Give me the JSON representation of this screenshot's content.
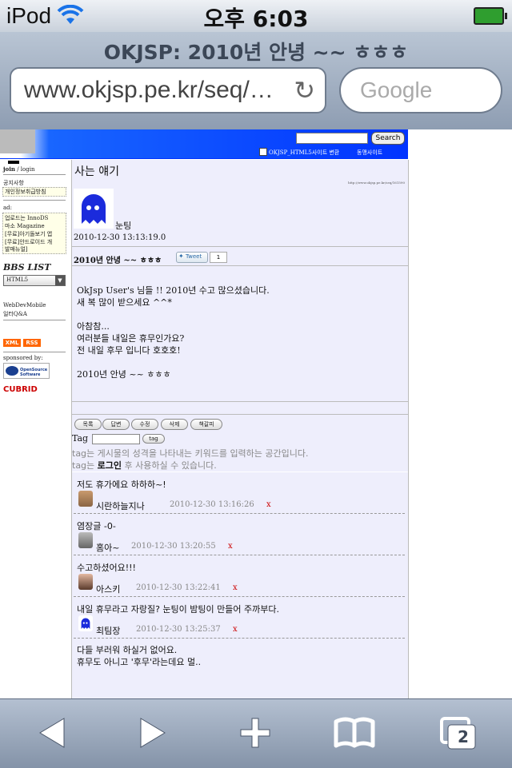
{
  "status": {
    "carrier": "iPod",
    "time": "오후 6:03"
  },
  "browser": {
    "title": "OKJSP: 2010년 안녕 ~~ ㅎㅎㅎ",
    "url": "www.okjsp.pe.kr/seq/…",
    "search_placeholder": "Google",
    "tabs_count": "2"
  },
  "site": {
    "search_button": "Search",
    "link_html5": "OKJSP_HTML5사이트 변환",
    "link_alumni": "동맹사이트"
  },
  "sidebar": {
    "join": "join",
    "sep": "/",
    "login": "login",
    "notice": "공지사항",
    "privacy": "개인정보취급방침",
    "ad_label": "ad:",
    "ads": [
      "업로드는 InnoDS",
      "마소 Magazine",
      "[무료]아기돌보기 앱",
      "[무료]안드로이드 개",
      "발매뉴얼]"
    ],
    "bbs_list": "BBS LIST",
    "bbs_select": "HTML5",
    "links": [
      "WebDevMobile",
      "일터Q&A"
    ],
    "xml": "XML",
    "rss": "RSS",
    "sponsored": "sponsored by:",
    "sponsor1": "OpenSource Software",
    "sponsor2": "CUBRID"
  },
  "post": {
    "board": "사는 얘기",
    "permalink": "http://www.okjsp.pe.kr/seq/161590",
    "author": "눈팅",
    "date": "2010-12-30 13:13:19.0",
    "title": "2010년 안녕 ~~ ㅎㅎㅎ",
    "tweet": "Tweet",
    "tweet_count": "1",
    "body": [
      "OkJsp User's 님들 !! 2010년 수고 많으셨습니다.",
      "새 복 많이 받으세요 ^^*",
      "",
      "아참참...",
      "여러분들 내일은 휴무인가요?",
      "전 내일 후무 입니다 호호호!",
      "",
      "2010년 안녕 ~~ ㅎㅎㅎ"
    ],
    "buttons": [
      "목록",
      "답변",
      "수정",
      "삭제",
      "책갈피"
    ],
    "tag_label": "Tag",
    "tag_button": "tag",
    "tag_help1": "tag는 게시물의 성격을 나타내는 키워드를 입력하는 공간입니다.",
    "tag_help2_pre": "tag는",
    "tag_help2_login": "로그인",
    "tag_help2_post": "후 사용하실 수 있습니다."
  },
  "comments": [
    {
      "text": "저도 휴가에요 하하하~!",
      "author": "시란하늘지나",
      "date": "2010-12-30 13:16:26",
      "del": "x"
    },
    {
      "text": "염장글 -0-",
      "author": "홈아~",
      "date": "2010-12-30 13:20:55",
      "del": "x"
    },
    {
      "text": "수고하셨어요!!!",
      "author": "아스키",
      "date": "2010-12-30 13:22:41",
      "del": "x"
    },
    {
      "text": "내일 휴무라고 자랑질? 눈팅이 밤팅이 만들어 주까부다.",
      "author": "최팀장",
      "date": "2010-12-30 13:25:37",
      "del": "x"
    }
  ],
  "last_comment": [
    "다들 부러워 하실거 없어요.",
    "휴무도 아니고 '후무'라는데요 멀.."
  ],
  "colors": {
    "site_blue": "#0033ff",
    "content_bg": "#eeeefc",
    "delete_red": "#cc0000"
  }
}
